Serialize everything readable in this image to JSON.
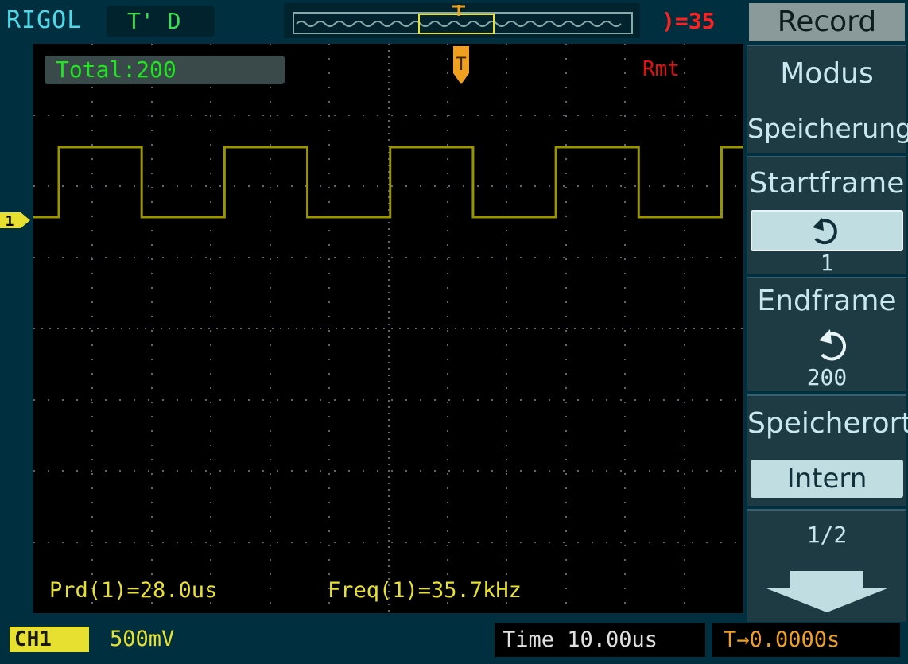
{
  "top": {
    "brand": "RIGOL",
    "trigger_status": "T' D",
    "trigger_level": ")=35"
  },
  "screen": {
    "total_label": "Total:200",
    "remote": "Rmt",
    "measurements": {
      "period": "Prd(1)=28.0us",
      "frequency": "Freq(1)=35.7kHz"
    },
    "channel_marker": "1",
    "trigger_marker": "T"
  },
  "bottom": {
    "channel_tag": "CH1",
    "channel_scale": "500mV",
    "time": "Time 10.00us",
    "trigger_offset": "T→0.0000s"
  },
  "menu": {
    "title": "Record",
    "modus_label": "Modus",
    "modus_value": "Speicherung",
    "startframe_label": "Startframe",
    "startframe_value": "1",
    "endframe_label": "Endframe",
    "endframe_value": "200",
    "speicherort_label": "Speicherort",
    "speicherort_value": "Intern",
    "page": "1/2"
  },
  "colors": {
    "waveform": "#9a9400",
    "background": "#003040",
    "grid": "#000000",
    "text_green": "#22e522",
    "text_yellow": "#e8e030",
    "menu_button": "#c0dde2"
  }
}
